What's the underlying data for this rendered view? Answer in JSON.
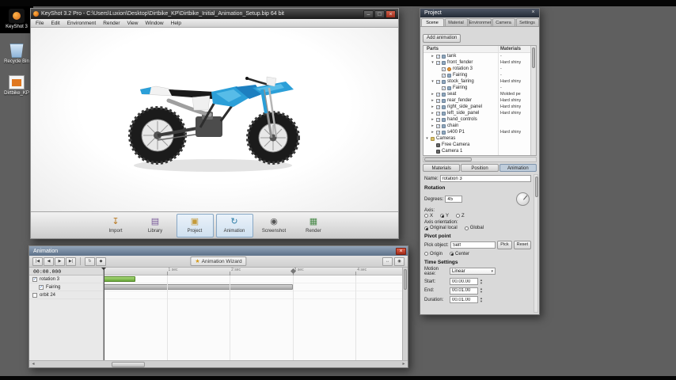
{
  "colors": {
    "accent_blue": "#2b9fd8",
    "timeline_green": "#76b043",
    "timeline_gray": "#b3b3b3",
    "close_red": "#c0392b"
  },
  "ui": {
    "check_glyph": "✓",
    "spin_up": "▲",
    "spin_down": "▼",
    "select_arrow": "▾",
    "scroll_left": "◂",
    "scroll_right": "▸"
  },
  "desktop": {
    "icons": [
      {
        "label": "KeyShot 3",
        "kind": "keyshot"
      },
      {
        "label": "Recycle Bin",
        "kind": "recycle"
      },
      {
        "label": "Dirtbike_KP",
        "kind": "file"
      }
    ]
  },
  "keyshot": {
    "title": "KeyShot 3.2 Pro - C:\\Users\\Luxion\\Desktop\\Dirtbike_KP\\Dirtbike_Initial_Animation_Setup.bip 64 bit",
    "window_buttons": {
      "minimize": "–",
      "maximize": "□",
      "close": "×"
    },
    "menus": [
      "File",
      "Edit",
      "Environment",
      "Render",
      "View",
      "Window",
      "Help"
    ],
    "toolbar": [
      {
        "label": "Import",
        "icon": "import",
        "glyph": "↧",
        "active": false
      },
      {
        "label": "Library",
        "icon": "library",
        "glyph": "▤",
        "active": false
      },
      {
        "label": "Project",
        "icon": "project",
        "glyph": "▣",
        "active": true
      },
      {
        "label": "Animation",
        "icon": "animation",
        "glyph": "↻",
        "active": true
      },
      {
        "label": "Screenshot",
        "icon": "screenshot",
        "glyph": "◉",
        "active": false
      },
      {
        "label": "Render",
        "icon": "render",
        "glyph": "▦",
        "active": false
      }
    ]
  },
  "animation": {
    "title": "Animation",
    "close_glyph": "×",
    "playback": [
      {
        "name": "go-to-start-button",
        "glyph": "|◀"
      },
      {
        "name": "previous-frame-button",
        "glyph": "◀"
      },
      {
        "name": "play-button",
        "glyph": "▶"
      },
      {
        "name": "go-to-end-button",
        "glyph": "▶|"
      }
    ],
    "tool_buttons": [
      {
        "name": "loop-playback-button",
        "glyph": "↻"
      },
      {
        "name": "add-keyframe-button",
        "glyph": "◆"
      }
    ],
    "wizard": {
      "glyph": "★",
      "label": "Animation Wizard"
    },
    "right_buttons": [
      {
        "name": "fit-timeline-button",
        "glyph": "↔"
      },
      {
        "name": "timeline-zoom-button",
        "glyph": "◉"
      }
    ],
    "time_display": "00:00.000",
    "tracks": [
      {
        "name": "rotation 3",
        "checked": true,
        "indent": 0,
        "bar": {
          "left_pct": 0,
          "width_pct": 10.5,
          "kind": "green"
        }
      },
      {
        "name": "Fairing",
        "checked": true,
        "indent": 1,
        "bar": {
          "left_pct": 0,
          "width_pct": 63.5,
          "kind": "gray"
        }
      },
      {
        "name": "orbit 24",
        "checked": false,
        "indent": 0,
        "bar": null
      }
    ],
    "ruler_ticks": [
      {
        "label": "1 sec",
        "pct": 21.1
      },
      {
        "label": "2 sec",
        "pct": 42.2
      },
      {
        "label": "3 sec",
        "pct": 63.3
      },
      {
        "label": "4 sec",
        "pct": 84.4
      }
    ],
    "playhead_pct": 0,
    "end_marker_pct": 63.5
  },
  "project": {
    "title": "Project",
    "close_glyph": "×",
    "tabs": [
      "Scene",
      "Material",
      "Environment",
      "Camera",
      "Settings"
    ],
    "active_tab": "Scene",
    "add_animation_label": "Add animation",
    "parts_header": "Parts",
    "materials_header": "Materials",
    "tree": [
      {
        "label": "tank",
        "level": 1,
        "arrow": "collapsed",
        "check": true,
        "icon": "part",
        "material": "-"
      },
      {
        "label": "front_fender",
        "level": 1,
        "arrow": "expanded",
        "check": true,
        "icon": "part",
        "material": "Hard shiny"
      },
      {
        "label": "rotation 3",
        "level": 2,
        "arrow": null,
        "check": true,
        "icon": "anim",
        "material": "-"
      },
      {
        "label": "Fairing",
        "level": 2,
        "arrow": null,
        "check": true,
        "icon": "part",
        "material": "-"
      },
      {
        "label": "stock_fairing",
        "level": 1,
        "arrow": "expanded",
        "check": true,
        "icon": "part",
        "material": "Hard shiny"
      },
      {
        "label": "Fairing",
        "level": 2,
        "arrow": null,
        "check": true,
        "icon": "part",
        "material": "-"
      },
      {
        "label": "seat",
        "level": 1,
        "arrow": "collapsed",
        "check": true,
        "icon": "part",
        "material": "Molded pe"
      },
      {
        "label": "rear_fender",
        "level": 1,
        "arrow": "collapsed",
        "check": true,
        "icon": "part",
        "material": "Hard shiny"
      },
      {
        "label": "right_side_panel",
        "level": 1,
        "arrow": "collapsed",
        "check": true,
        "icon": "part",
        "material": "Hard shiny"
      },
      {
        "label": "left_side_panel",
        "level": 1,
        "arrow": "collapsed",
        "check": true,
        "icon": "part",
        "material": "Hard shiny"
      },
      {
        "label": "hand_controls",
        "level": 1,
        "arrow": "collapsed",
        "check": true,
        "icon": "part",
        "material": ""
      },
      {
        "label": "chain",
        "level": 1,
        "arrow": "collapsed",
        "check": true,
        "icon": "part",
        "material": ""
      },
      {
        "label": "s400 P1",
        "level": 1,
        "arrow": "collapsed",
        "check": true,
        "icon": "part",
        "material": "Hard shiny"
      },
      {
        "label": "Cameras",
        "level": 0,
        "arrow": "expanded",
        "check": null,
        "icon": "group",
        "material": ""
      },
      {
        "label": "Free Camera",
        "level": 1,
        "arrow": null,
        "check": null,
        "icon": "camera",
        "material": ""
      },
      {
        "label": "Camera 1",
        "level": 1,
        "arrow": null,
        "check": null,
        "icon": "camera",
        "material": ""
      }
    ],
    "sub_tabs": [
      "Materials",
      "Position",
      "Animation"
    ],
    "active_sub_tab": "Animation",
    "props": {
      "name_label": "Name:",
      "name_value": "rotation 3",
      "rotation_header": "Rotation",
      "degrees_label": "Degrees:",
      "degrees_value": "45",
      "axis_label": "Axis:",
      "axis_options": [
        {
          "label": "X",
          "selected": false
        },
        {
          "label": "Y",
          "selected": true
        },
        {
          "label": "Z",
          "selected": false
        }
      ],
      "orientation_label": "Axis orientation:",
      "orientation_options": [
        {
          "label": "Original local",
          "selected": true
        },
        {
          "label": "Global",
          "selected": false
        }
      ],
      "pivot_header": "Pivot point",
      "pivot_object_label": "Pick object:",
      "pivot_object_value": "Self",
      "pick_button": "Pick",
      "reset_button": "Reset",
      "pivot_options": [
        {
          "label": "Origin",
          "selected": false
        },
        {
          "label": "Center",
          "selected": true
        }
      ],
      "time_header": "Time Settings",
      "motion_ease_label": "Motion ease:",
      "motion_ease_value": "Linear",
      "start_label": "Start:",
      "start_value": "00.00.00",
      "end_label": "End:",
      "end_value": "00.01.00",
      "duration_label": "Duration:",
      "duration_value": "00.01.00"
    }
  }
}
